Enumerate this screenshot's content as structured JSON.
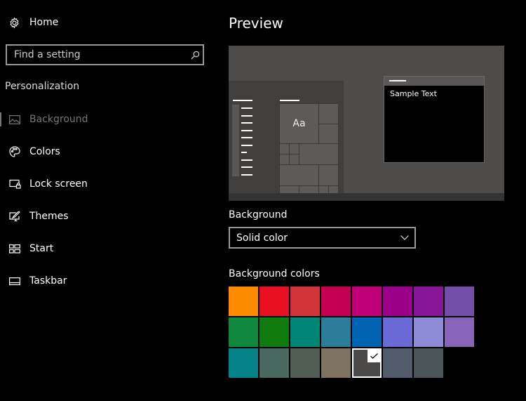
{
  "sidebar": {
    "home_label": "Home",
    "search_placeholder": "Find a setting",
    "section_label": "Personalization",
    "items": [
      {
        "label": "Background",
        "icon": "picture-icon",
        "active": true
      },
      {
        "label": "Colors",
        "icon": "palette-icon",
        "active": false
      },
      {
        "label": "Lock screen",
        "icon": "lock-screen-icon",
        "active": false
      },
      {
        "label": "Themes",
        "icon": "themes-icon",
        "active": false
      },
      {
        "label": "Start",
        "icon": "start-icon",
        "active": false
      },
      {
        "label": "Taskbar",
        "icon": "taskbar-icon",
        "active": false
      }
    ]
  },
  "main": {
    "title": "Preview",
    "preview": {
      "tile_label": "Aa",
      "window_text": "Sample Text",
      "background_color": "#4e4c4b"
    },
    "background_label": "Background",
    "background_dropdown_value": "Solid color",
    "colors_label": "Background colors",
    "selected_color_index": 20,
    "colors": [
      "#ff8c00",
      "#e81123",
      "#d13438",
      "#c30052",
      "#bf0077",
      "#9a0089",
      "#881798",
      "#744da9",
      "#10893e",
      "#107c10",
      "#018574",
      "#2d7d9a",
      "#0063b1",
      "#6b69d6",
      "#8e8cd8",
      "#8764b8",
      "#038387",
      "#486860",
      "#525e54",
      "#7e735f",
      "#4c4a48",
      "#515c6b",
      "#4a5459"
    ]
  }
}
